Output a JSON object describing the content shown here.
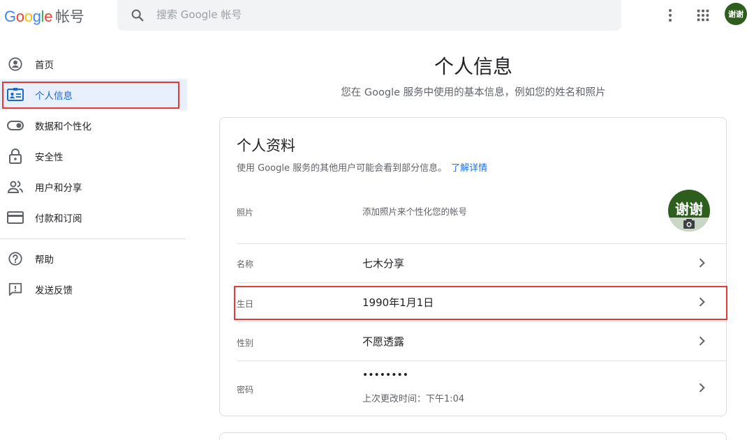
{
  "header": {
    "logo_letters": [
      "G",
      "o",
      "o",
      "g",
      "l",
      "e"
    ],
    "product": "帐号",
    "search_placeholder": "搜索 Google 帐号",
    "avatar_text": "谢谢"
  },
  "sidebar": {
    "items": [
      {
        "label": "首页",
        "icon": "home-icon"
      },
      {
        "label": "个人信息",
        "icon": "id-card-icon",
        "active": true
      },
      {
        "label": "数据和个性化",
        "icon": "toggle-icon"
      },
      {
        "label": "安全性",
        "icon": "lock-icon"
      },
      {
        "label": "用户和分享",
        "icon": "people-icon"
      },
      {
        "label": "付款和订阅",
        "icon": "credit-card-icon"
      }
    ],
    "secondary": [
      {
        "label": "帮助",
        "icon": "help-icon"
      },
      {
        "label": "发送反馈",
        "icon": "feedback-icon"
      }
    ]
  },
  "main": {
    "title": "个人信息",
    "subtitle": "您在 Google 服务中使用的基本信息，例如您的姓名和照片"
  },
  "profile": {
    "title": "个人资料",
    "description": "使用 Google 服务的其他用户可能会看到部分信息。",
    "learn_more": "了解详情",
    "photo": {
      "label": "照片",
      "value": "添加照片来个性化您的帐号",
      "avatar_text": "谢谢"
    },
    "name": {
      "label": "名称",
      "value": "七木分享"
    },
    "birthday": {
      "label": "生日",
      "value": "1990年1月1日"
    },
    "gender": {
      "label": "性别",
      "value": "不愿透露"
    },
    "password": {
      "label": "密码",
      "value": "••••••••",
      "last_changed": "上次更改时间：下午1:04"
    }
  },
  "colors": {
    "accent": "#1a73e8",
    "active_bg": "#e8f0fe",
    "highlight": "#e53935",
    "avatar_bg": "#2e5e1e"
  }
}
